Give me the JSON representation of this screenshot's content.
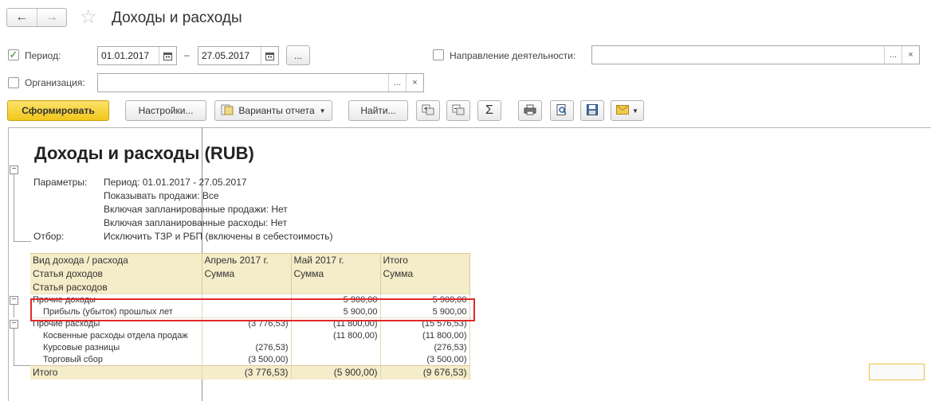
{
  "window": {
    "title": "Доходы и расходы"
  },
  "nav": {
    "back": "←",
    "forward": "→",
    "star": "☆"
  },
  "form": {
    "period_label": "Период:",
    "period_checked": true,
    "date_from": "01.01.2017",
    "date_sep": "–",
    "date_to": "27.05.2017",
    "ellipsis": "...",
    "direction_label": "Направление деятельности:",
    "direction_value": "",
    "org_label": "Организация:",
    "org_value": "",
    "clear": "×"
  },
  "toolbar": {
    "generate": "Сформировать",
    "settings": "Настройки...",
    "variants": "Варианты отчета",
    "find": "Найти...",
    "sum": "Σ",
    "icons": [
      "expand-icon",
      "collapse-icon",
      "sum-icon",
      "print-icon",
      "preview-icon",
      "save-icon",
      "mail-icon"
    ]
  },
  "report": {
    "title": "Доходы и расходы (RUB)",
    "params_label": "Параметры:",
    "params": [
      "Период: 01.01.2017 - 27.05.2017",
      "Показывать продажи: Все",
      "Включая запланированные продажи: Нет",
      "Включая запланированные расходы: Нет"
    ],
    "filter_label": "Отбор:",
    "filter_value": "Исключить ТЗР и РБП (включены в себестоимость)",
    "table": {
      "header_row1": [
        "Вид дохода / расхода",
        "Апрель 2017 г.",
        "Май 2017 г.",
        "Итого"
      ],
      "header_row2": [
        "Статья доходов",
        "Сумма",
        "Сумма",
        "Сумма"
      ],
      "header_row3": [
        "Статья расходов",
        "",
        "",
        ""
      ],
      "rows": [
        {
          "name": "Прочие доходы",
          "apr": "",
          "may": "5 900,00",
          "total": "5 900,00",
          "level": 0
        },
        {
          "name": "Прибыль (убыток) прошлых лет",
          "apr": "",
          "may": "5 900,00",
          "total": "5 900,00",
          "level": 1
        },
        {
          "name": "Прочие расходы",
          "apr": "(3 776,53)",
          "may": "(11 800,00)",
          "total": "(15 576,53)",
          "level": 0
        },
        {
          "name": "Косвенные расходы отдела продаж",
          "apr": "",
          "may": "(11 800,00)",
          "total": "(11 800,00)",
          "level": 1
        },
        {
          "name": "Курсовые разницы",
          "apr": "(276,53)",
          "may": "",
          "total": "(276,53)",
          "level": 1
        },
        {
          "name": "Торговый сбор",
          "apr": "(3 500,00)",
          "may": "",
          "total": "(3 500,00)",
          "level": 1
        }
      ],
      "total": {
        "name": "Итого",
        "apr": "(3 776,53)",
        "may": "(5 900,00)",
        "total": "(9 676,53)"
      }
    }
  }
}
